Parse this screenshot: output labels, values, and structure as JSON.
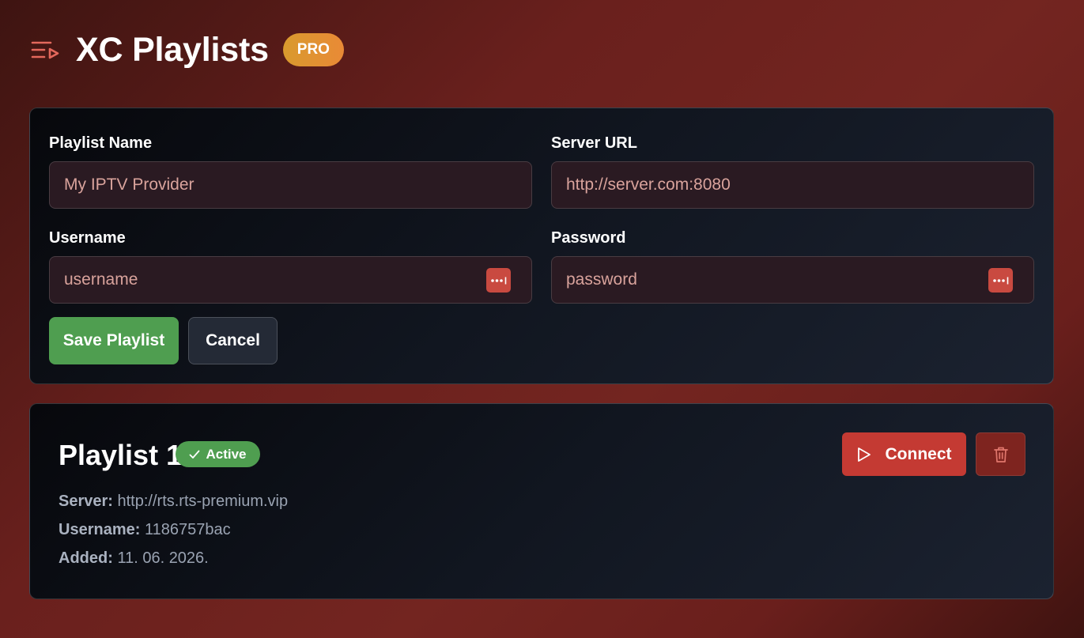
{
  "app": {
    "title": "XC Playlists",
    "badge": "PRO",
    "menu_icon": "playlist-icon"
  },
  "form": {
    "playlist_name": {
      "label": "Playlist Name",
      "placeholder": "My IPTV Provider"
    },
    "server_url": {
      "label": "Server URL",
      "placeholder": "http://server.com:8080"
    },
    "username": {
      "label": "Username",
      "placeholder": "username"
    },
    "password": {
      "label": "Password",
      "placeholder": "password",
      "toggle_icon": "password-dots-icon"
    },
    "save_label": "Save Playlist",
    "cancel_label": "Cancel"
  },
  "playlists": [
    {
      "name": "Playlist 1",
      "status": "Active",
      "server_label": "Server:",
      "server": "http://rts.rts-premium.vip",
      "username_label": "Username:",
      "username": "1186757bac",
      "added_label": "Added:",
      "added": "11. 06. 2026.",
      "connect_label": "Connect",
      "delete_icon": "trash-icon"
    }
  ],
  "colors": {
    "accent_red": "#c43a33",
    "success_green": "#4f9e50",
    "pro_gold": "#e0922f"
  }
}
